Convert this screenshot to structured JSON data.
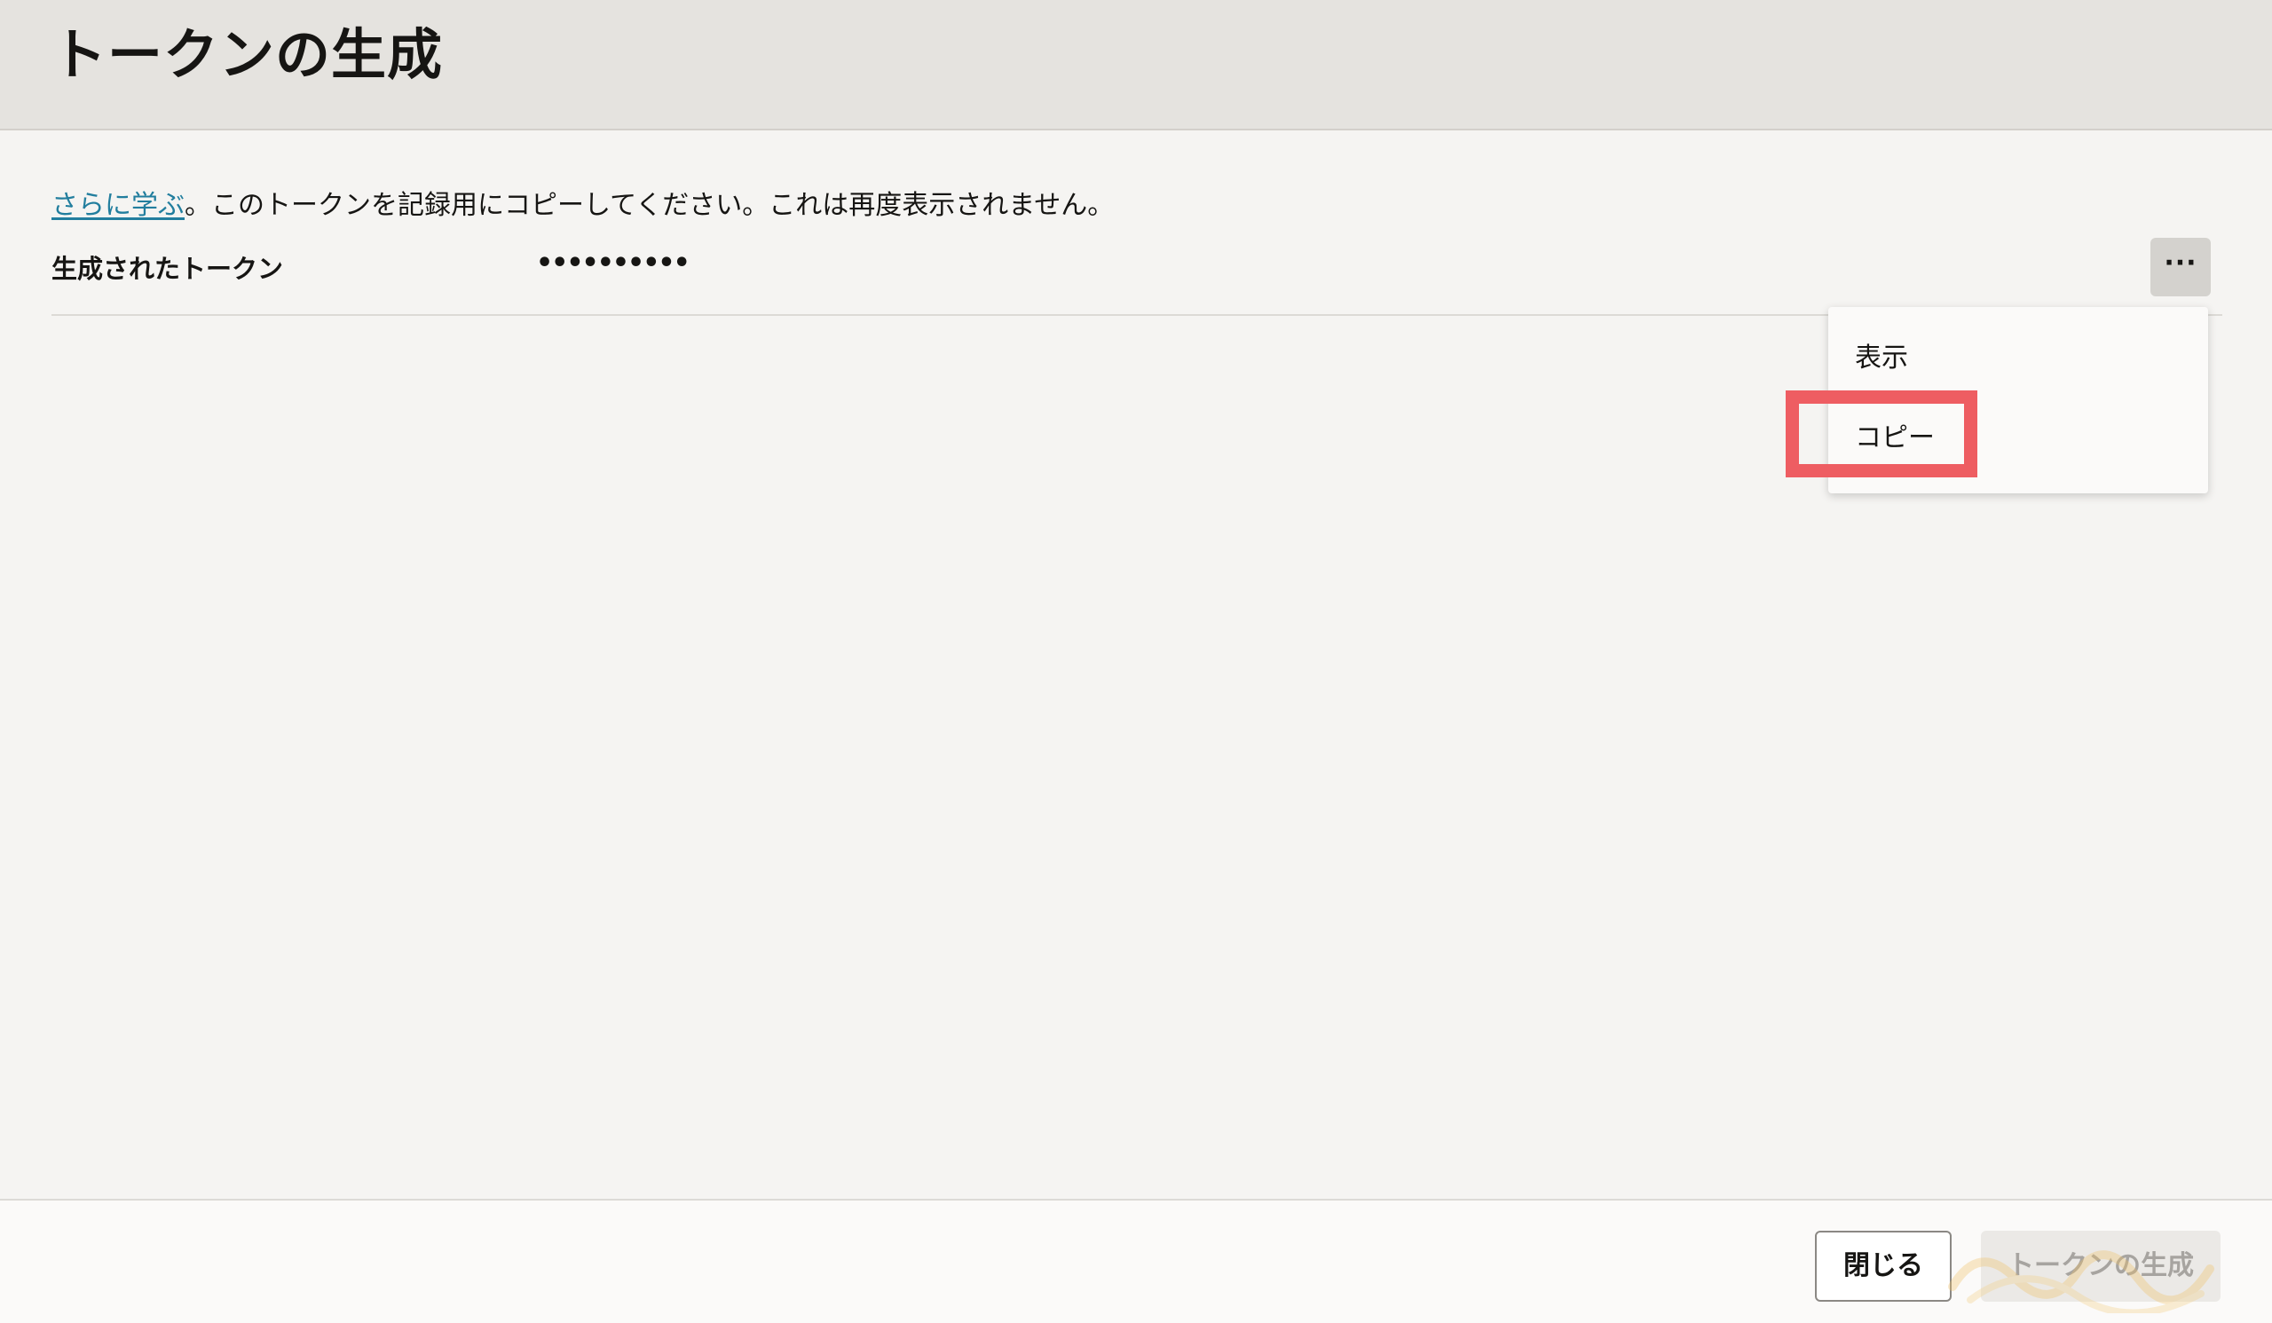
{
  "header": {
    "title": "トークンの生成"
  },
  "info": {
    "link_text": "さらに学ぶ",
    "message": "。このトークンを記録用にコピーしてください。これは再度表示されません。"
  },
  "token_row": {
    "label": "生成されたトークン",
    "masked_value": "••••••••••",
    "actions_label": "···"
  },
  "actions_menu": {
    "items": [
      {
        "label": "表示"
      },
      {
        "label": "コピー"
      }
    ],
    "highlighted_item": "コピー",
    "highlight_color": "#ee5d62"
  },
  "footer": {
    "close_label": "閉じる",
    "generate_label": "トークンの生成"
  },
  "colors": {
    "link": "#227e9e",
    "header_bg": "#e5e3df",
    "page_bg": "#f5f4f2"
  }
}
